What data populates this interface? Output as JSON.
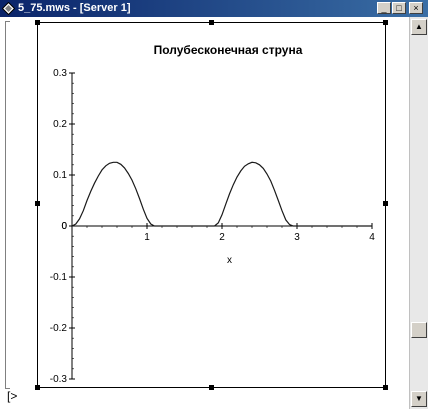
{
  "window": {
    "title": "5_75.mws - [Server 1]",
    "icon": "maple-diamond-icon",
    "buttons": {
      "minimize": "_",
      "maximize": "□",
      "close": "×"
    }
  },
  "document": {
    "prompt": "[>"
  },
  "scrollbar": {
    "up": "▲",
    "down": "▼"
  },
  "chart_data": {
    "type": "line",
    "title": "Полубесконечная струна",
    "xlabel": "x",
    "ylabel": "",
    "xlim": [
      0,
      4
    ],
    "ylim": [
      -0.3,
      0.3
    ],
    "x_ticks": [
      "0",
      "1",
      "2",
      "3",
      "4"
    ],
    "y_ticks": [
      "-0.3",
      "-0.2",
      "-0.1",
      "0",
      "0.1",
      "0.2",
      "0.3"
    ],
    "color": "#1a1a1a",
    "series": [
      {
        "x": [
          0,
          0.05,
          0.1,
          0.15,
          0.2,
          0.25,
          0.3,
          0.35,
          0.4,
          0.45,
          0.5,
          0.55,
          0.6,
          0.65,
          0.7,
          0.75,
          0.8,
          0.85,
          0.9,
          0.95,
          1.0,
          1.05,
          1.1,
          1.2,
          1.4,
          1.6,
          1.8,
          1.9,
          1.95,
          2.0,
          2.05,
          2.1,
          2.15,
          2.2,
          2.25,
          2.3,
          2.35,
          2.4,
          2.45,
          2.5,
          2.55,
          2.6,
          2.65,
          2.7,
          2.75,
          2.8,
          2.85,
          2.9,
          2.95,
          3.0,
          3.2,
          3.5,
          4.0
        ],
        "y": [
          0,
          0.004,
          0.014,
          0.03,
          0.05,
          0.068,
          0.084,
          0.098,
          0.11,
          0.118,
          0.123,
          0.125,
          0.125,
          0.121,
          0.114,
          0.103,
          0.09,
          0.073,
          0.054,
          0.033,
          0.015,
          0.004,
          0,
          0,
          0,
          0,
          0,
          0,
          0.006,
          0.022,
          0.043,
          0.063,
          0.081,
          0.096,
          0.108,
          0.117,
          0.122,
          0.125,
          0.124,
          0.12,
          0.113,
          0.102,
          0.088,
          0.07,
          0.05,
          0.03,
          0.012,
          0.003,
          0,
          0,
          0,
          0,
          0
        ]
      }
    ]
  }
}
